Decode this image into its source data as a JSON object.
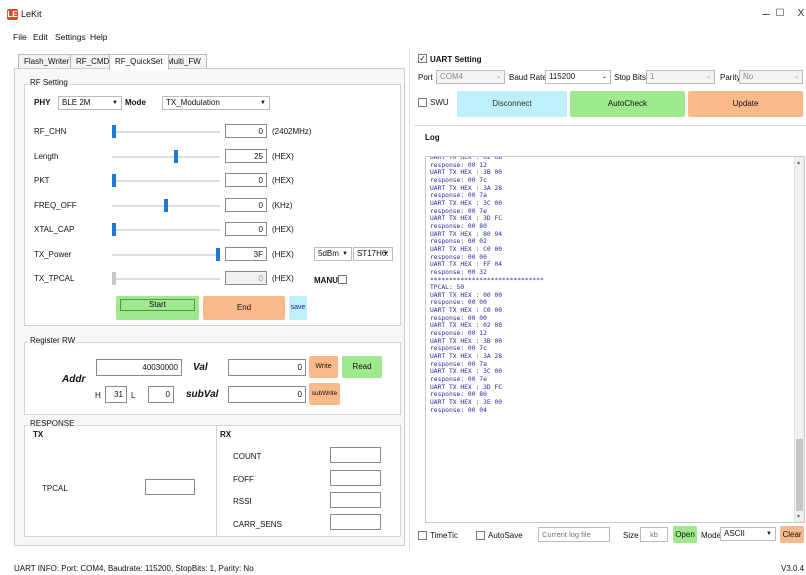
{
  "window": {
    "title": "LeKit",
    "logo": "LE",
    "minimize": "–",
    "maximize": "☐",
    "close": "X"
  },
  "menu": [
    "File",
    "Edit",
    "Settings",
    "Help"
  ],
  "tabs": [
    "Flash_Writer",
    "RF_CMD",
    "RF_QuickSet",
    "Multi_FW"
  ],
  "rf": {
    "group_label": "RF Setting",
    "phy_label": "PHY",
    "phy_value": "BLE 2M",
    "mode_label": "Mode",
    "mode_value": "TX_Modulation",
    "rows": [
      {
        "label": "RF_CHN",
        "value": "0",
        "unit": "(2402MHz)",
        "level": 0.0
      },
      {
        "label": "Length",
        "value": "25",
        "unit": "(HEX)",
        "level": 0.6
      },
      {
        "label": "PKT",
        "value": "0",
        "unit": "(HEX)",
        "level": 0.0
      },
      {
        "label": "FREQ_OFF",
        "value": "0",
        "unit": "(KHz)",
        "level": 0.5
      },
      {
        "label": "XTAL_CAP",
        "value": "0",
        "unit": "(HEX)",
        "level": 0.0
      },
      {
        "label": "TX_Power",
        "value": "3F",
        "unit": "(HEX)",
        "level": 1.0
      },
      {
        "label": "TX_TPCAL",
        "value": "0",
        "unit": "(HEX)",
        "level": 0.0
      }
    ],
    "power_select": "5dBm",
    "chip_select": "ST17H6:",
    "manu_label": "MANU",
    "start_label": "Start",
    "end_label": "End",
    "save_label": "save"
  },
  "reg": {
    "group_label": "Register RW",
    "addr_label": "Addr",
    "addr_value": "40030000",
    "h_label": "H",
    "h_value": "31",
    "l_label": "L",
    "l_value": "0",
    "val_label": "Val",
    "val_value": "0",
    "subval_label": "subVal",
    "subval_value": "0",
    "write_label": "Write",
    "read_label": "Read",
    "subwrite_label": "subWrite"
  },
  "resp": {
    "group_label": "RESPONSE",
    "tx_label": "TX",
    "rx_label": "RX",
    "tpcal_label": "TPCAL",
    "rx_fields": [
      "COUNT",
      "FOFF",
      "RSSI",
      "CARR_SENS"
    ]
  },
  "uart": {
    "setting_label": "UART Setting",
    "port_label": "Port",
    "port_value": "COM4",
    "baud_label": "Baud Rate",
    "baud_value": "115200",
    "stop_label": "Stop Bits",
    "stop_value": "1",
    "parity_label": "Parity",
    "parity_value": "No",
    "swu_label": "SWU",
    "disconnect_label": "Disconnect",
    "autocheck_label": "AutoCheck",
    "update_label": "Update"
  },
  "log": {
    "label": "Log",
    "lines": [
      "UART TX HEX : 02 08",
      "response: 00 12",
      "UART TX HEX : 3B 00",
      "response: 00 7c",
      "UART TX HEX : 3A 28",
      "response: 00 7a",
      "UART TX HEX : 3C 00",
      "response: 00 7e",
      "UART TX HEX : 3D FC",
      "response: 00 80",
      "UART TX HEX : 80 94",
      "response: 00 02",
      "UART TX HEX : C0 00",
      "response: 00 00",
      "UART TX HEX : FF 04",
      "response: 00 32",
      "******************************",
      "TPCAL: 50",
      "UART TX HEX : 00 00",
      "response: 00 00",
      "UART TX HEX : C0 00",
      "response: 00 00",
      "UART TX HEX : 02 08",
      "response: 00 12",
      "UART TX HEX : 3B 00",
      "response: 00 7c",
      "UART TX HEX : 3A 28",
      "response: 00 7a",
      "UART TX HEX : 3C 00",
      "response: 00 7e",
      "UART TX HEX : 3D FC",
      "response: 00 80",
      "UART TX HEX : 3E 00",
      "response: 00 04"
    ]
  },
  "footer": {
    "timetic_label": "TimeTic",
    "autosave_label": "AutoSave",
    "logfile_placeholder": "Current log file",
    "size_label": "Size",
    "size_placeholder": "kb",
    "open_label": "Open",
    "mode_label": "Mode",
    "mode_value": "ASCII",
    "clear_label": "Clear"
  },
  "status": {
    "text": "UART INFO: Port: COM4, Baudrate: 115200, StopBits: 1, Parity: No",
    "version": "V3.0.4"
  }
}
